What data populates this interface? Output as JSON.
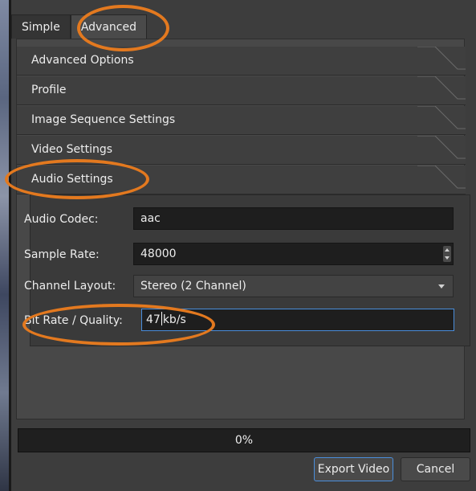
{
  "tabs": [
    {
      "label": "Simple",
      "active": false
    },
    {
      "label": "Advanced",
      "active": true
    }
  ],
  "sections": [
    {
      "label": "Advanced Options"
    },
    {
      "label": "Profile"
    },
    {
      "label": "Image Sequence Settings"
    },
    {
      "label": "Video Settings"
    },
    {
      "label": "Audio Settings"
    }
  ],
  "audio": {
    "codec_label": "Audio Codec:",
    "codec_value": "aac",
    "sample_rate_label": "Sample Rate:",
    "sample_rate_value": "48000",
    "channel_layout_label": "Channel Layout:",
    "channel_layout_value": "Stereo (2 Channel)",
    "bitrate_label": "Bit Rate / Quality:",
    "bitrate_value_before_caret": "47",
    "bitrate_value_after_caret": "kb/s"
  },
  "progress": {
    "text": "0%",
    "value": 0
  },
  "buttons": {
    "export": "Export Video",
    "cancel": "Cancel"
  },
  "colors": {
    "annotation": "#e3791f",
    "focus": "#4a8edc"
  }
}
